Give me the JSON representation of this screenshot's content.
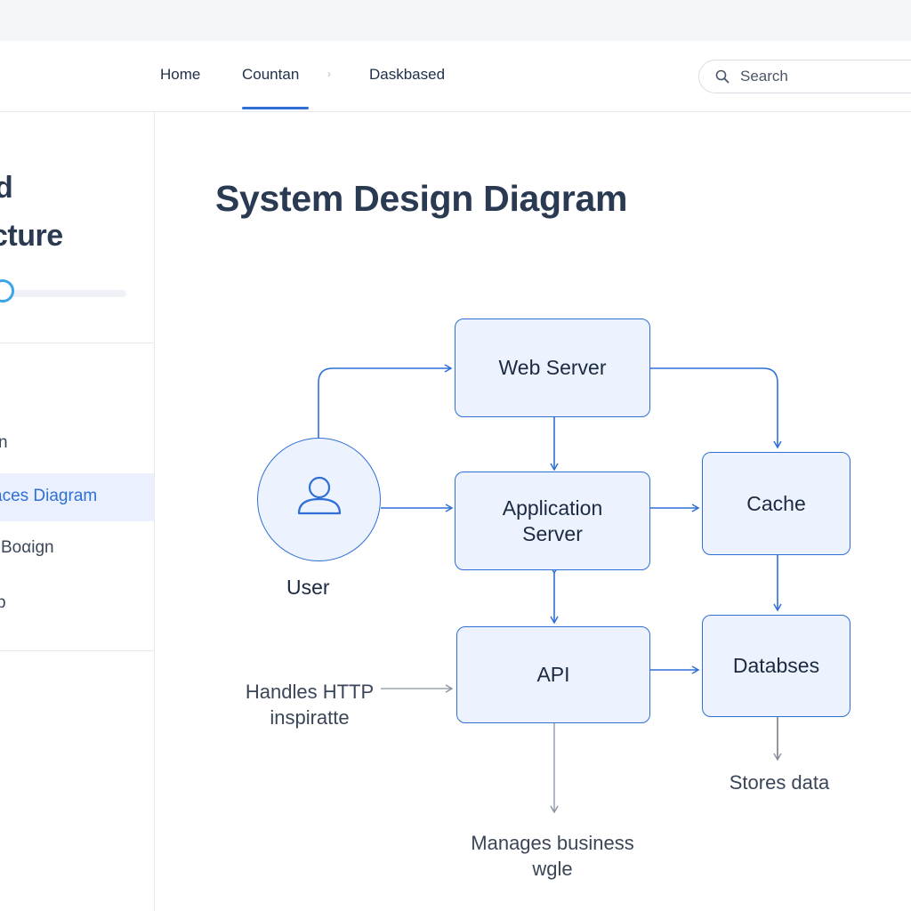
{
  "navbar": {
    "items": [
      {
        "label": "Home",
        "active": false
      },
      {
        "label": "Countan",
        "active": true
      },
      {
        "label": "Daskbased",
        "active": false
      }
    ],
    "separator": "›"
  },
  "search": {
    "placeholder": "Search",
    "value": ""
  },
  "sidebar": {
    "title_line1": "d",
    "title_line2": "cture",
    "items": [
      {
        "label": "n",
        "active": false
      },
      {
        "label": "aces Diagram",
        "active": true
      },
      {
        "label": "Boαign",
        "active": false
      },
      {
        "label": "p",
        "active": false
      }
    ]
  },
  "main": {
    "title": "System Design Diagram"
  },
  "diagram": {
    "nodes": {
      "web_server": "Web Server",
      "app_server": "Application\nServer",
      "cache": "Cache",
      "api": "API",
      "database": "Databses",
      "user": "User"
    },
    "annotations": {
      "http": "Handles HTTP\ninspiratte",
      "business": "Manages business\nwgle",
      "store": "Stores data"
    }
  },
  "colors": {
    "accent": "#2f6fd6",
    "node_fill": "#edf3fe",
    "text": "#22324a",
    "sidebar_active_bg": "#eaf0fd",
    "progress": "#3aa4ea"
  }
}
